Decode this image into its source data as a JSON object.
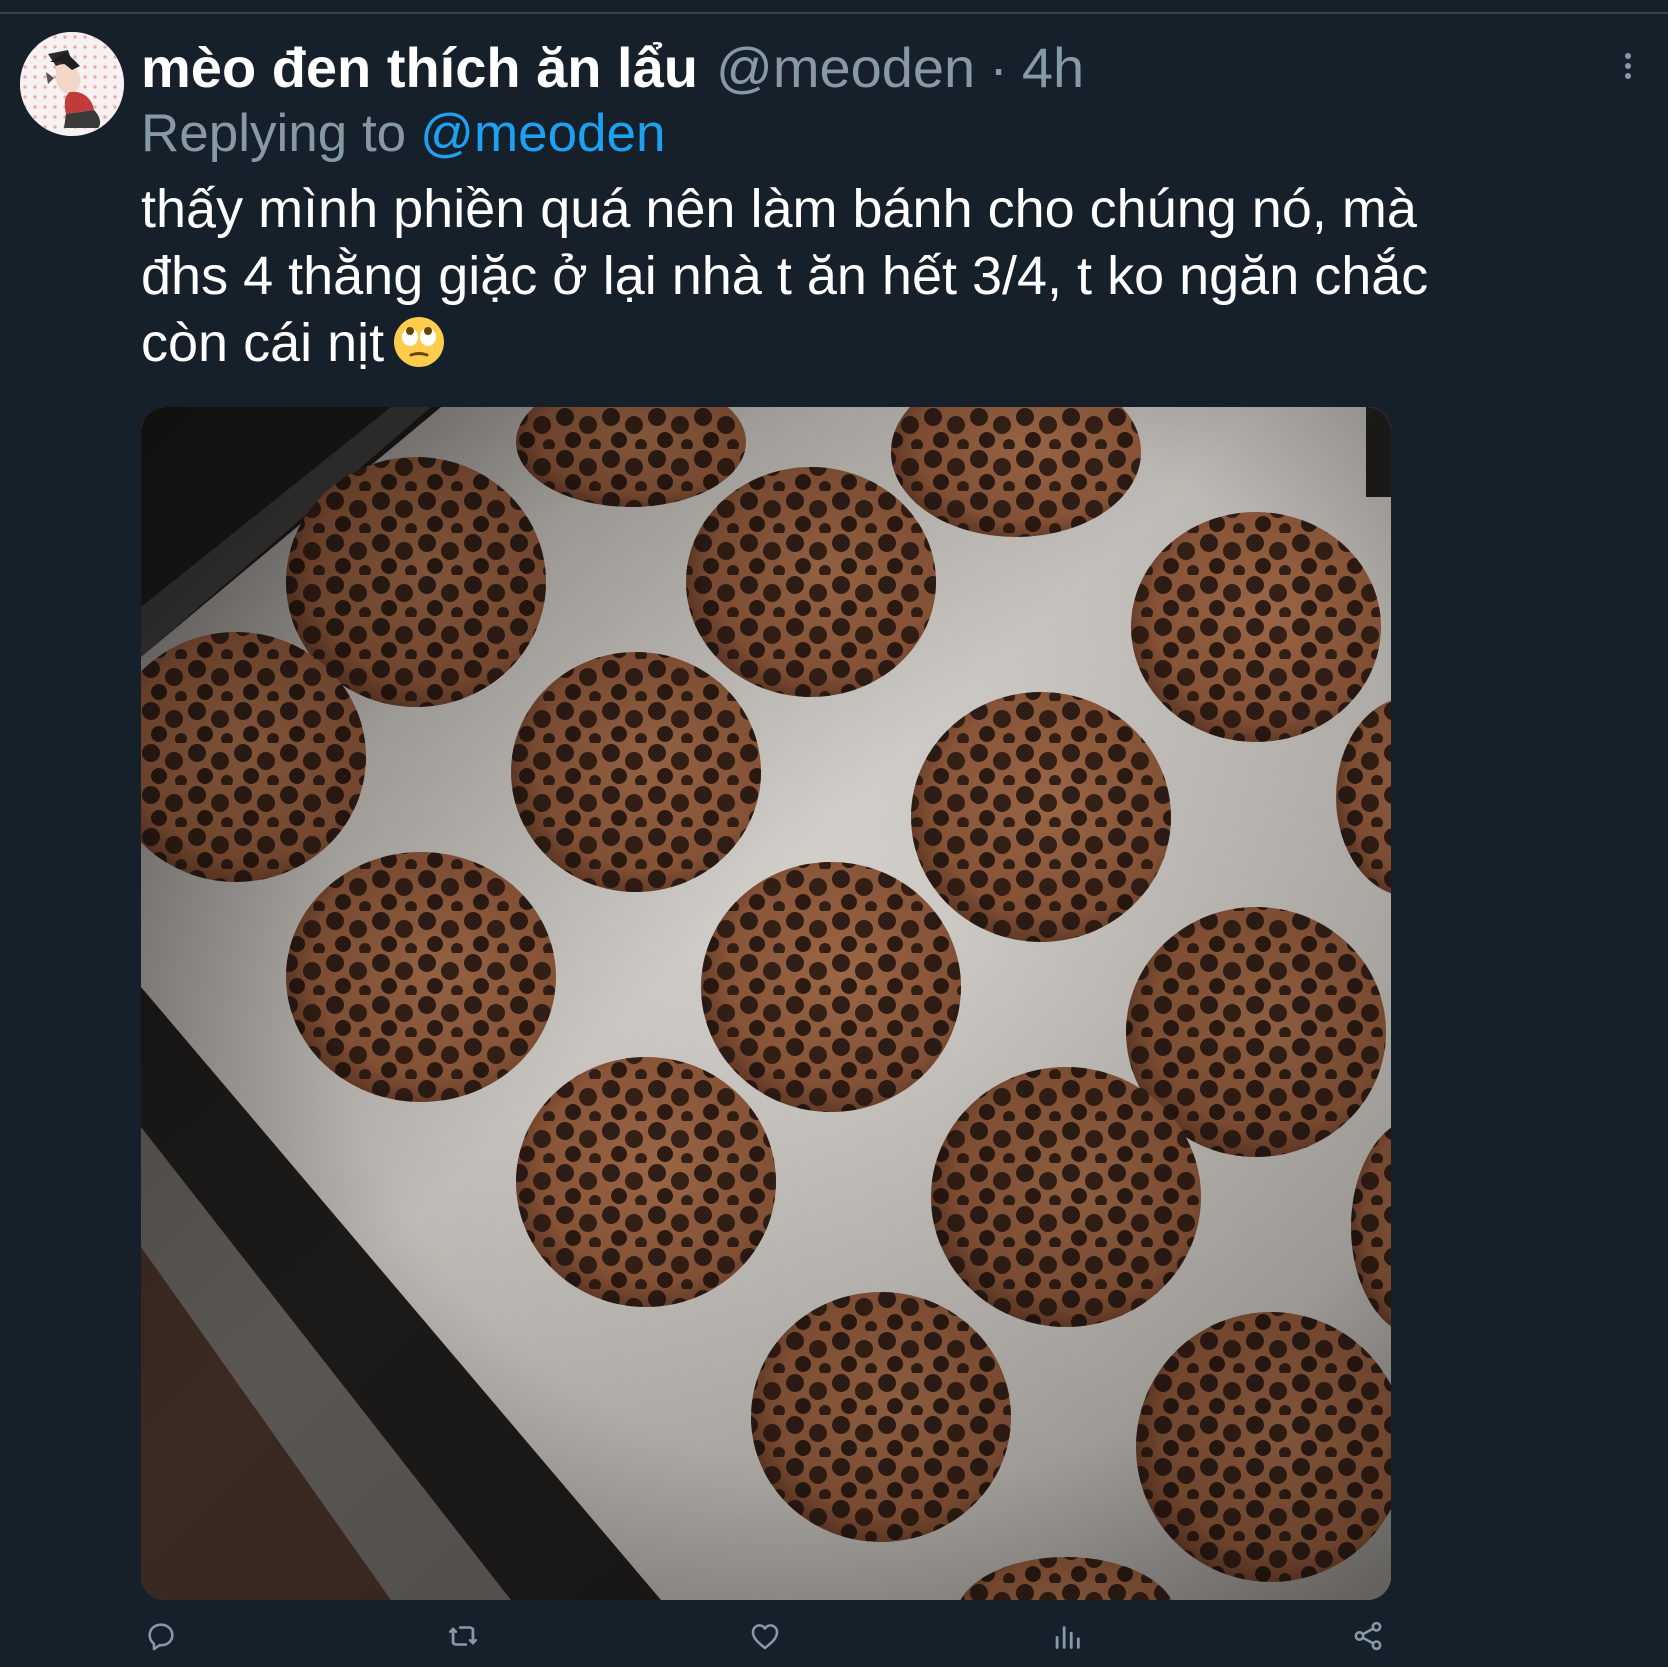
{
  "tweet": {
    "display_name": "mèo đen thích ăn lẩu",
    "handle": "@meoden",
    "separator": "·",
    "time": "4h",
    "replying_to_label": "Replying to",
    "replying_to_handle": "@meoden",
    "text_lines": [
      "thấy mình phiền quá nên làm bánh cho chúng nó, mà",
      "đhs 4 thằng giặc ở lại nhà t ăn hết 3/4, t ko ngăn chắc",
      "còn cái nịt"
    ],
    "emoji": "face-with-rolling-eyes",
    "media": {
      "subject": "chocolate-chip-cookies-on-baking-tray"
    }
  },
  "actions": {
    "icons": [
      "reply-icon",
      "retweet-icon",
      "like-icon",
      "analytics-icon",
      "share-icon"
    ]
  },
  "colors": {
    "background": "#15202b",
    "primary_text": "#ffffff",
    "secondary_text": "#8899a6",
    "accent": "#1da1f2",
    "divider": "#38444d"
  }
}
